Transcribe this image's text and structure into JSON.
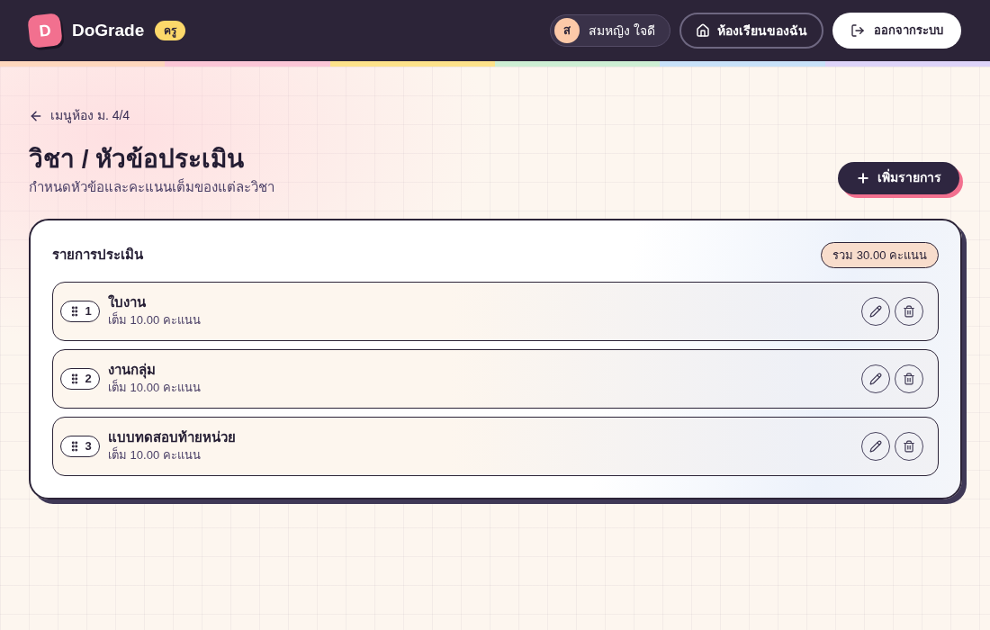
{
  "header": {
    "logo_letter": "D",
    "app_name": "DoGrade",
    "role_badge": "ครู",
    "user": {
      "avatar_initial": "ส",
      "name": "สมหญิง ใจดี"
    },
    "my_classes_button": "ห้องเรียนของฉัน",
    "logout_button": "ออกจากระบบ"
  },
  "page": {
    "back_link": "เมนูห้อง ม. 4/4",
    "title": "วิชา / หัวข้อประเมิน",
    "subtitle": "กำหนดหัวข้อและคะแนนเต็มของแต่ละวิชา",
    "add_button": "เพิ่มรายการ"
  },
  "list": {
    "title": "รายการประเมิน",
    "total_badge": "รวม 30.00 คะแนน",
    "items": [
      {
        "order": "1",
        "name": "ใบงาน",
        "max_score": "เต็ม 10.00 คะแนน"
      },
      {
        "order": "2",
        "name": "งานกลุ่ม",
        "max_score": "เต็ม 10.00 คะแนน"
      },
      {
        "order": "3",
        "name": "แบบทดสอบท้ายหน่วย",
        "max_score": "เต็ม 10.00 คะแนน"
      }
    ]
  }
}
